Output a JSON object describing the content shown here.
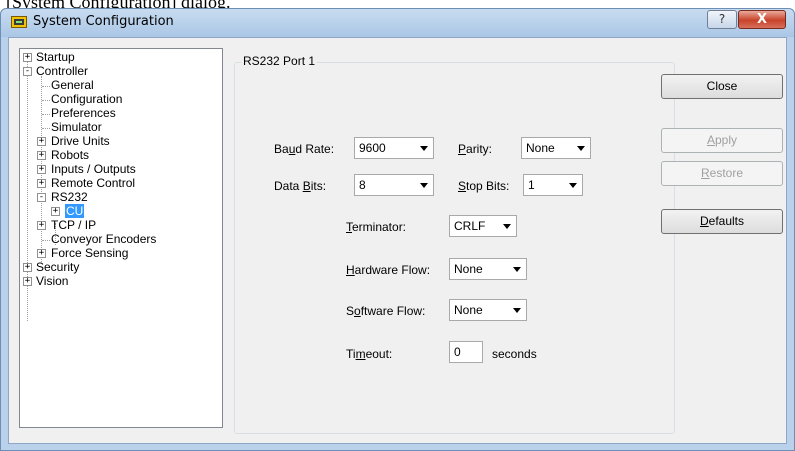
{
  "caption": "[System Configuration] dialog.",
  "window": {
    "title": "System Configuration",
    "help_label": "?",
    "close_label": "X"
  },
  "tree": {
    "items": [
      {
        "label": "Startup",
        "expander": "+"
      },
      {
        "label": "Controller",
        "expander": "-"
      },
      {
        "label": "General"
      },
      {
        "label": "Configuration"
      },
      {
        "label": "Preferences"
      },
      {
        "label": "Simulator"
      },
      {
        "label": "Drive Units",
        "expander": "+"
      },
      {
        "label": "Robots",
        "expander": "+"
      },
      {
        "label": "Inputs / Outputs",
        "expander": "+"
      },
      {
        "label": "Remote Control",
        "expander": "+"
      },
      {
        "label": "RS232",
        "expander": "-"
      },
      {
        "label": "CU",
        "expander": "+",
        "selected": true
      },
      {
        "label": "TCP / IP",
        "expander": "+"
      },
      {
        "label": "Conveyor Encoders"
      },
      {
        "label": "Force Sensing",
        "expander": "+"
      },
      {
        "label": "Security",
        "expander": "+"
      },
      {
        "label": "Vision",
        "expander": "+"
      }
    ]
  },
  "panel": {
    "group_title": "RS232 Port 1",
    "baud_rate": {
      "label_pre": "Ba",
      "label_u": "u",
      "label_post": "d Rate:",
      "value": "9600"
    },
    "parity": {
      "label_pre": "",
      "label_u": "P",
      "label_post": "arity:",
      "value": "None"
    },
    "data_bits": {
      "label_pre": "Data ",
      "label_u": "B",
      "label_post": "its:",
      "value": "8"
    },
    "stop_bits": {
      "label_pre": "",
      "label_u": "S",
      "label_post": "top Bits:",
      "value": "1"
    },
    "terminator": {
      "label_pre": "",
      "label_u": "T",
      "label_post": "erminator:",
      "value": "CRLF"
    },
    "hardware_flow": {
      "label_pre": "",
      "label_u": "H",
      "label_post": "ardware Flow:",
      "value": "None"
    },
    "software_flow": {
      "label_pre": "S",
      "label_u": "o",
      "label_post": "ftware Flow:",
      "value": "None"
    },
    "timeout": {
      "label_pre": "Ti",
      "label_u": "m",
      "label_post": "eout:",
      "value": "0",
      "unit": "seconds"
    }
  },
  "buttons": {
    "close": "Close",
    "apply": {
      "pre": "",
      "u": "A",
      "post": "pply"
    },
    "restore": {
      "pre": "",
      "u": "R",
      "post": "estore"
    },
    "defaults": {
      "pre": "",
      "u": "D",
      "post": "efaults"
    }
  }
}
